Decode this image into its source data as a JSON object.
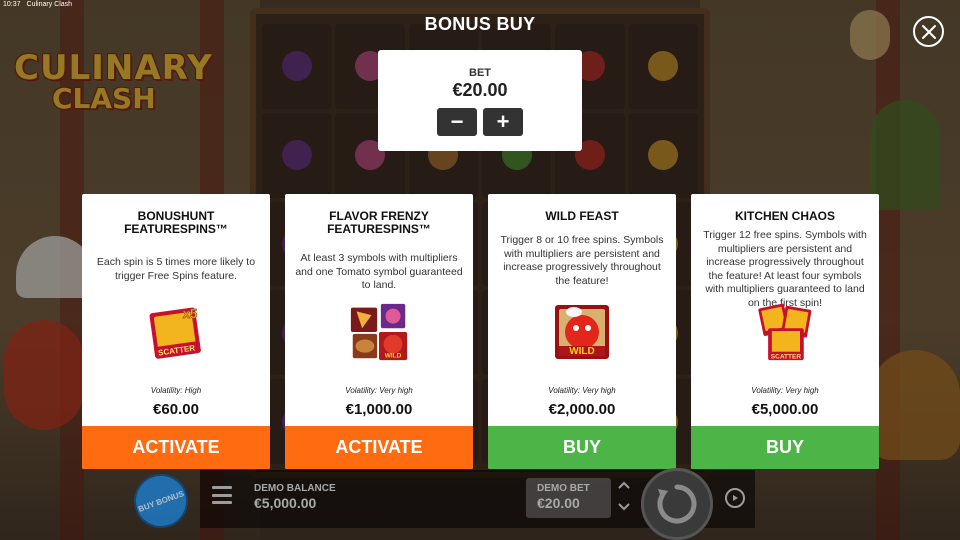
{
  "os_bar": {
    "time": "10:37",
    "window_title": "Culinary Clash"
  },
  "game": {
    "logo_line1": "CULINARY",
    "logo_line2": "CLASH"
  },
  "modal": {
    "title": "BONUS BUY",
    "close_icon": "close-icon",
    "bet": {
      "label": "BET",
      "value": "€20.00",
      "decrease_label": "−",
      "increase_label": "+"
    }
  },
  "cards": [
    {
      "title": "BONUSHUNT FEATURESPINS™",
      "description": "Each spin is 5 times more likely to trigger Free Spins feature.",
      "icon": "scatter-x5-icon",
      "icon_text": "SCATTER",
      "icon_mult": "x5",
      "volatility": "Volatility: High",
      "price": "€60.00",
      "action": "ACTIVATE",
      "action_color": "#ff6b10"
    },
    {
      "title": "FLAVOR FRENZY FEATURESPINS™",
      "description": "At least 3 symbols with multipliers and one Tomato symbol guaranteed to land.",
      "icon": "symbol-collage-icon",
      "icon_text": "WILD",
      "volatility": "Volatility: Very high",
      "price": "€1,000.00",
      "action": "ACTIVATE",
      "action_color": "#ff6b10"
    },
    {
      "title": "WILD FEAST",
      "description": "Trigger 8 or 10 free spins. Symbols with multipliers are persistent and increase progressively throughout the feature!",
      "icon": "tomato-wild-icon",
      "icon_text": "WILD",
      "volatility": "Volatility: Very high",
      "price": "€2,000.00",
      "action": "BUY",
      "action_color": "#4db548"
    },
    {
      "title": "KITCHEN CHAOS",
      "description": "Trigger 12 free spins. Symbols with multipliers are persistent and increase progressively throughout the feature! At least four symbols with multipliers guaranteed to land on the first spin!",
      "icon": "scatter-stack-icon",
      "icon_text": "SCATTER",
      "volatility": "Volatility: Very high",
      "price": "€5,000.00",
      "action": "BUY",
      "action_color": "#4db548"
    }
  ],
  "bottom_bar": {
    "buy_bonus_label": "BUY BONUS",
    "demo_balance_label": "DEMO BALANCE",
    "demo_balance_value": "€5,000.00",
    "demo_bet_label": "DEMO BET",
    "demo_bet_value": "€20.00",
    "icons": [
      "menu-icon",
      "chevron-up-icon",
      "chevron-down-icon",
      "spin-icon",
      "autoplay-icon"
    ]
  },
  "colors": {
    "activate": "#ff6b10",
    "buy": "#4db548",
    "bet_button": "#333333"
  }
}
